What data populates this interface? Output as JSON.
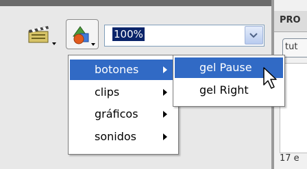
{
  "toolbar": {
    "zoom_value": "100%",
    "icons": [
      "edit-scene-icon",
      "edit-symbols-icon",
      "zoom-dropdown-icon"
    ]
  },
  "menu": {
    "items": [
      {
        "label": "botones",
        "has_submenu": true,
        "selected": true
      },
      {
        "label": "clips",
        "has_submenu": true,
        "selected": false
      },
      {
        "label": "gráficos",
        "has_submenu": true,
        "selected": false
      },
      {
        "label": "sonidos",
        "has_submenu": true,
        "selected": false
      }
    ]
  },
  "submenu": {
    "items": [
      {
        "label": "gel Pause",
        "selected": true
      },
      {
        "label": "gel Right",
        "selected": false
      }
    ]
  },
  "right_panel": {
    "title": "PRO",
    "tab_label": "tut",
    "status": "17 e"
  },
  "colors": {
    "selection": "#316ac5",
    "zoom_highlight": "#0a246a"
  }
}
